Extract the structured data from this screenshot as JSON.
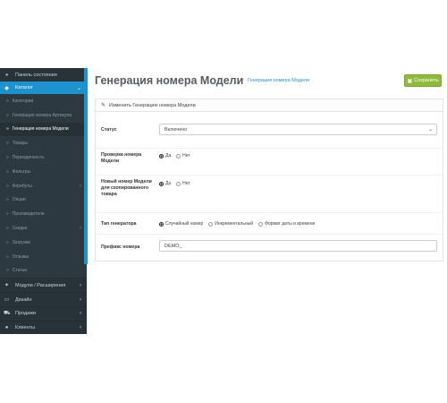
{
  "sidebar": {
    "dashboard": "Панель состояния",
    "catalog": "Каталог",
    "catalog_items": [
      "Категории",
      "Генерация номера Артикула",
      "Генерация номера Модели",
      "Товары",
      "Периодичность",
      "Фильтры",
      "Атрибуты",
      "Опции",
      "Производители",
      "Скидки",
      "Загрузки",
      "Отзывы",
      "Статьи"
    ],
    "main_items": [
      "Модули / Расширения",
      "Дизайн",
      "Продажи",
      "Клиенты"
    ]
  },
  "header": {
    "title": "Генерация номера Модели",
    "breadcrumb": "Генерация номера Модели",
    "save_label": "Сохранить"
  },
  "panel": {
    "heading": "Изменить Генерацию номера Модели",
    "status": {
      "label": "Статус",
      "value": "Включено"
    },
    "check_model": {
      "label": "Проверка номера Модели",
      "options": [
        "Да",
        "Нет"
      ],
      "selected": "Да"
    },
    "new_model_copy": {
      "label": "Новый номер Модели для скопированного товара",
      "options": [
        "Да",
        "Нет"
      ],
      "selected": "Да"
    },
    "generator_type": {
      "label": "Тип генератора",
      "options": [
        "Случайный номер",
        "Инкрементальный",
        "Формат даты и времени"
      ],
      "selected": "Случайный номер"
    },
    "prefix": {
      "label": "Префикс номера",
      "value": "DEMO_"
    }
  },
  "colors": {
    "sidebar_bg": "#2d3941",
    "accent": "#1e91cf",
    "save_green": "#8fbb3c"
  }
}
